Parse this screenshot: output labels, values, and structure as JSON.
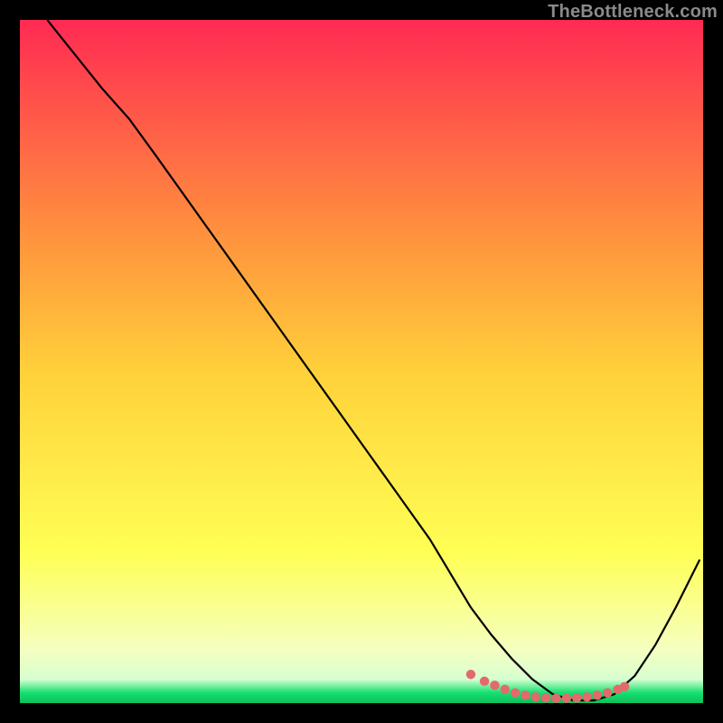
{
  "watermark": "TheBottleneck.com",
  "chart_data": {
    "type": "line",
    "title": "",
    "xlabel": "",
    "ylabel": "",
    "xlim": [
      0,
      100
    ],
    "ylim": [
      0,
      100
    ],
    "background_gradient": {
      "top": "#ff2a53",
      "mid_upper": "#ff8d3e",
      "mid": "#ffd23a",
      "mid_lower": "#ffff55",
      "near_bottom": "#f5ffbf",
      "bottom": "#14e06f"
    },
    "series": [
      {
        "name": "curve",
        "color": "#000000",
        "x": [
          4,
          8,
          12,
          16,
          20,
          25,
          30,
          35,
          40,
          45,
          50,
          55,
          60,
          63,
          66,
          69,
          72,
          75,
          78,
          81,
          84,
          87,
          90,
          93,
          96,
          99.5
        ],
        "y": [
          100,
          95,
          90,
          85.5,
          80,
          73,
          66,
          59,
          52,
          45,
          38,
          31,
          24,
          19,
          14,
          10,
          6.5,
          3.5,
          1.3,
          0.4,
          0.4,
          1.3,
          4,
          8.5,
          14,
          21
        ]
      },
      {
        "name": "valley-markers",
        "color": "#e26a6d",
        "x": [
          66,
          68,
          69.5,
          71,
          72.5,
          74,
          75.5,
          77,
          78.5,
          80,
          81.5,
          83,
          84.5,
          86,
          87.5,
          88.5
        ],
        "y": [
          4.2,
          3.2,
          2.6,
          2.0,
          1.5,
          1.15,
          0.9,
          0.75,
          0.7,
          0.7,
          0.75,
          0.9,
          1.15,
          1.5,
          2.0,
          2.4
        ]
      }
    ]
  }
}
